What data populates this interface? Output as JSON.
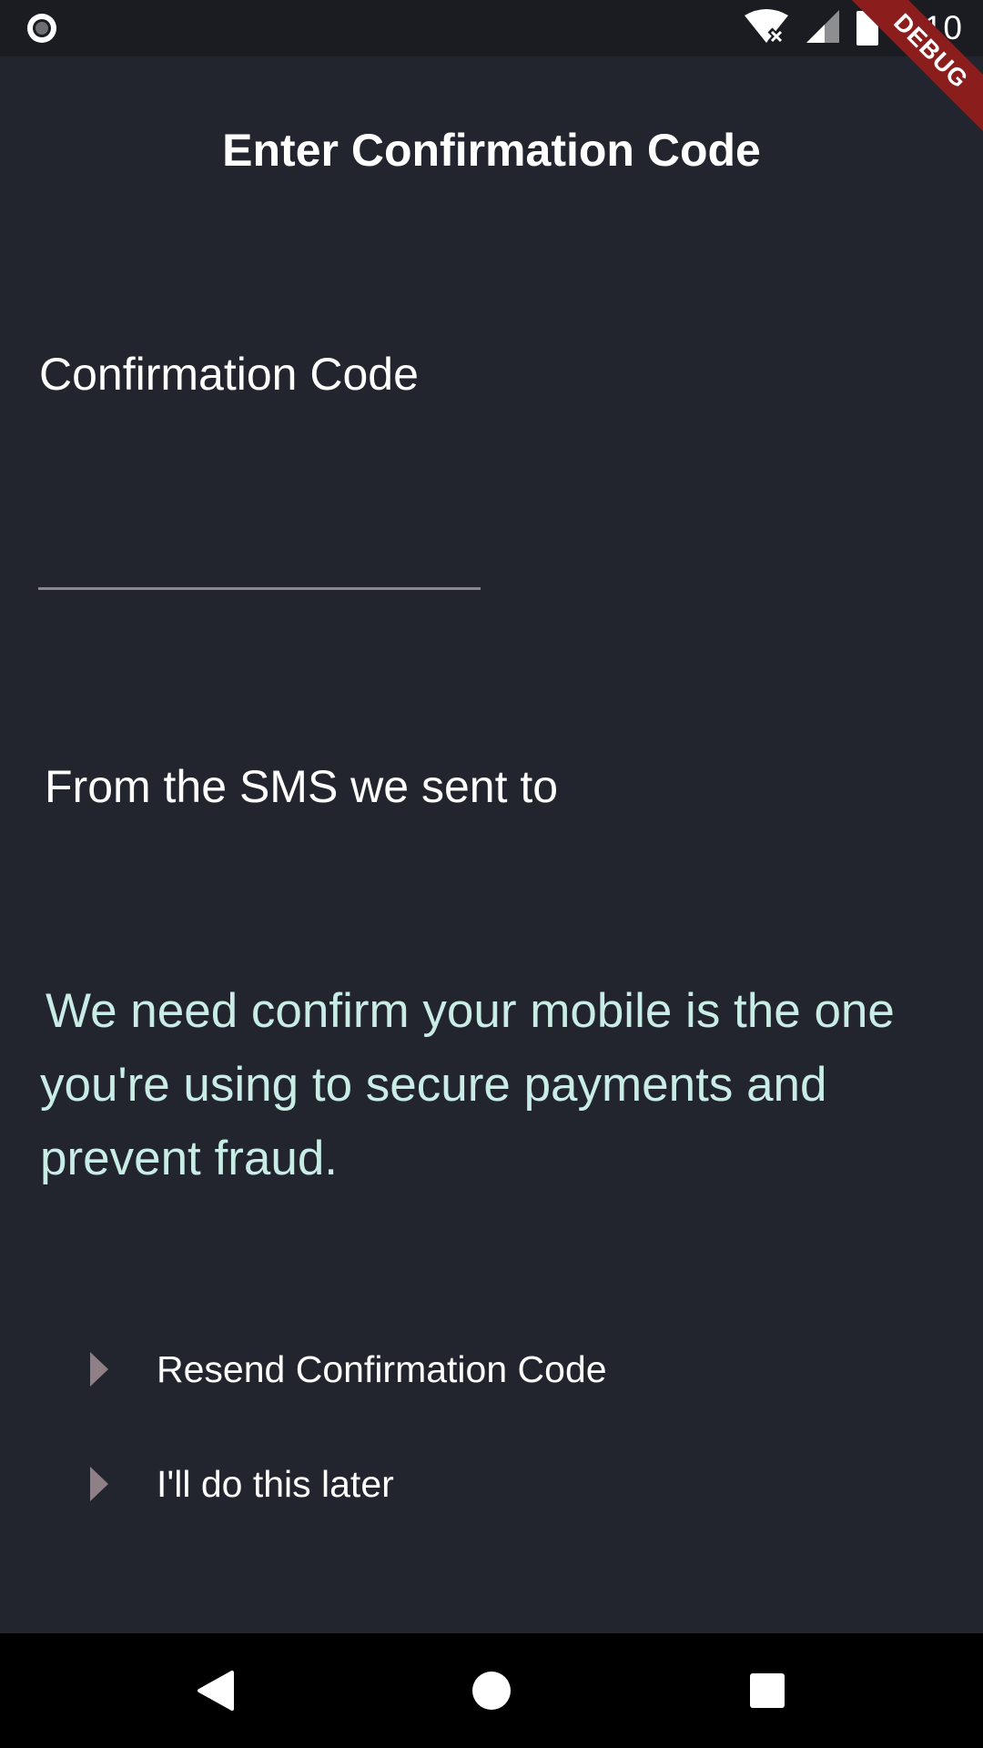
{
  "status_bar": {
    "time": "6:10",
    "icons": [
      "record-icon",
      "wifi-off-icon",
      "signal-icon",
      "battery-icon"
    ]
  },
  "debug_banner": {
    "label": "DEBUG",
    "color": "#8b1d1d"
  },
  "app_bar": {
    "title": "Enter Confirmation Code"
  },
  "form": {
    "field_label": "Confirmation Code",
    "input_value": "",
    "input_placeholder": ""
  },
  "sms_notice": "From the SMS we sent to",
  "info_message": "We need confirm your mobile is the one you're using to secure payments and prevent fraud.",
  "actions": [
    {
      "label": "Resend Confirmation Code",
      "icon": "play-arrow-icon"
    },
    {
      "label": "I'll do this later",
      "icon": "play-arrow-icon"
    }
  ],
  "nav_bar": {
    "buttons": [
      "back-icon",
      "home-icon",
      "recents-icon"
    ]
  },
  "colors": {
    "background": "#22242e",
    "status_bar": "#1a1c22",
    "info_text": "#c9ece6",
    "arrow": "#8f7f86",
    "underline": "#8a8790"
  }
}
